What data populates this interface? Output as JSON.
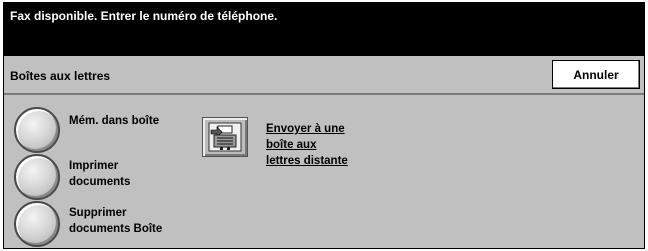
{
  "status": {
    "message": "Fax disponible. Entrer le numéro de téléphone."
  },
  "header": {
    "title": "Boîtes aux lettres",
    "cancel_label": "Annuler"
  },
  "options": [
    {
      "line1": "Mém. dans boîte",
      "line2": ""
    },
    {
      "line1": "Imprimer",
      "line2": "documents"
    },
    {
      "line1": "Supprimer",
      "line2": "documents Boîte"
    }
  ],
  "remote": {
    "line1": "Envoyer à une",
    "line2": "boîte aux",
    "line3": "lettres distante",
    "icon": "remote-mailbox-icon"
  },
  "colors": {
    "panel": "#c0c0c0",
    "status_bar": "#000000",
    "status_text": "#ffffff"
  }
}
